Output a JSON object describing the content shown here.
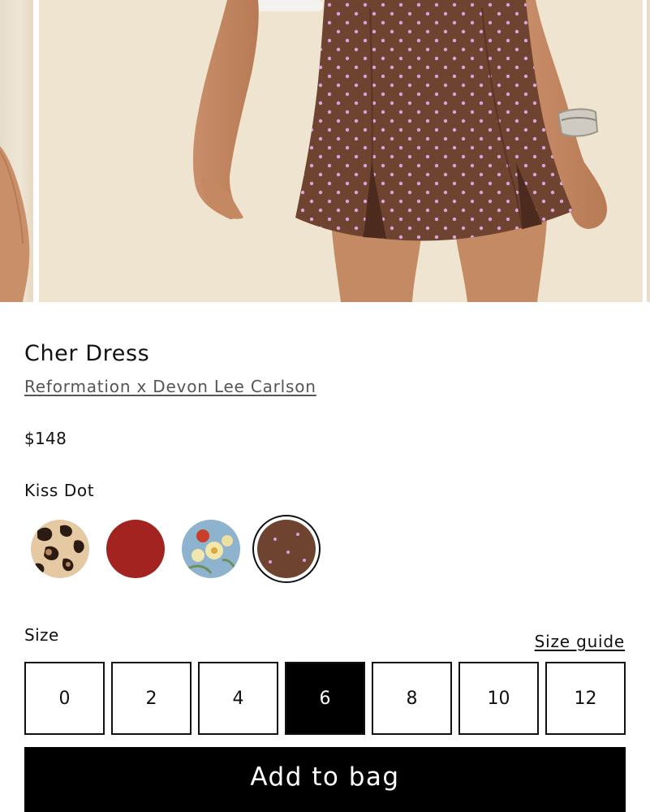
{
  "product": {
    "title": "Cher Dress",
    "brand": "Reformation x Devon Lee Carlson",
    "price": "$148",
    "color_name": "Kiss Dot"
  },
  "swatches": [
    {
      "name": "leopard",
      "selected": false
    },
    {
      "name": "red",
      "selected": false
    },
    {
      "name": "blue-floral",
      "selected": false
    },
    {
      "name": "brown-dot",
      "selected": true
    }
  ],
  "size": {
    "label": "Size",
    "guide_label": "Size guide",
    "options": [
      "0",
      "2",
      "4",
      "6",
      "8",
      "10",
      "12"
    ],
    "selected": "6"
  },
  "cta": {
    "add_to_bag": "Add to bag"
  },
  "colors": {
    "accent": "#000000",
    "text": "#111111",
    "link": "#555555",
    "dress_brown": "#6e4330",
    "dot_pink": "#d9a3e0",
    "swatch_red": "#a2231f"
  }
}
